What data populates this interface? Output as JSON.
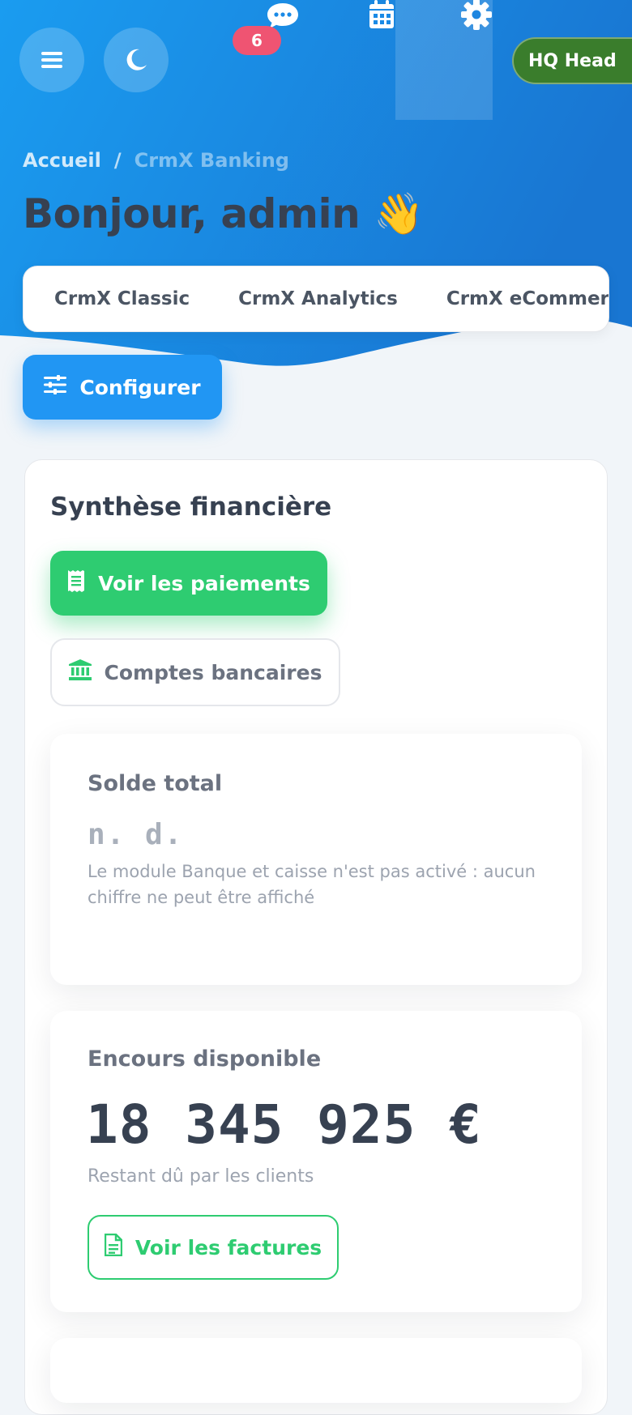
{
  "colors": {
    "header_gradient_start": "#1a9cf0",
    "header_gradient_end": "#1976d2",
    "primary": "#2196f3",
    "success": "#2ecc71",
    "badge": "#ef5472",
    "hq_pill": "#3a7d2c",
    "title_text": "#374151"
  },
  "topbar": {
    "menu_icon": "hamburger-icon",
    "theme_icon": "moon-icon",
    "chat_icon": "chat-bubble-icon",
    "notification_count": "6",
    "calendar_icon": "calendar-icon",
    "settings_icon": "gear-icon",
    "entity_label": "HQ Head"
  },
  "breadcrumb": {
    "home": "Accueil",
    "separator": "/",
    "current": "CrmX Banking"
  },
  "page": {
    "greeting": "Bonjour, admin 👋"
  },
  "tabs": [
    {
      "label": "CrmX Classic"
    },
    {
      "label": "CrmX Analytics"
    },
    {
      "label": "CrmX eCommerce"
    }
  ],
  "toolbar": {
    "configure_label": "Configurer",
    "configure_icon": "sliders-icon"
  },
  "finance": {
    "title": "Synthèse financière",
    "payments_label": "Voir les paiements",
    "payments_icon": "receipt-icon",
    "bank_accounts_label": "Comptes bancaires",
    "bank_icon": "bank-icon"
  },
  "cards": {
    "total_balance": {
      "label": "Solde total",
      "value": "n. d.",
      "note": "Le module Banque et caisse n'est pas activé : aucun chiffre ne peut être affiché"
    },
    "outstanding": {
      "label": "Encours disponible",
      "value": "18 345 925 €",
      "subtitle": "Restant dû par les clients",
      "invoices_label": "Voir les factures",
      "invoices_icon": "invoice-icon"
    }
  }
}
